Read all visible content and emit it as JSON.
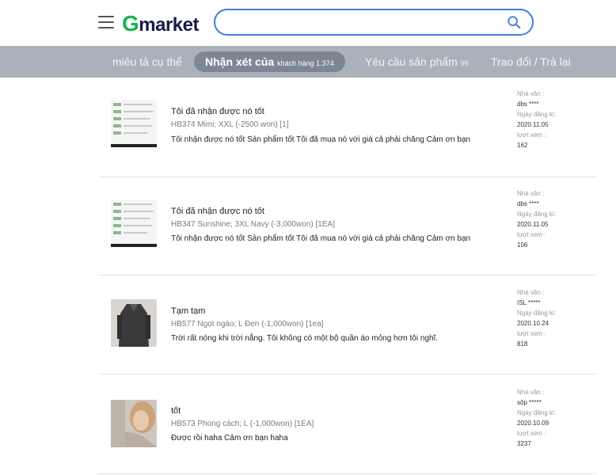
{
  "header": {
    "logo_g": "G",
    "logo_rest": "market",
    "search_placeholder": "",
    "brand_color": "#16b34a"
  },
  "tabs": [
    {
      "label": "miêu tả cụ thể",
      "extra": ""
    },
    {
      "label": "Nhận xét của",
      "extra": "khách hàng 1.374"
    },
    {
      "label": "Yêu cầu sản phẩm",
      "extra": "99"
    },
    {
      "label": "Trao đổi / Trả lại",
      "extra": ""
    }
  ],
  "active_tab": 1,
  "meta_labels": {
    "author": "Nhà văn :",
    "date": "Ngày đăng kí:",
    "views": "lượt xem :"
  },
  "reviews": [
    {
      "title": "Tôi đã nhận được nó tốt",
      "option": "HB374 Mimi; XXL (-2500 won) [1]",
      "text": "Tôi nhận được nó tốt Sản phẩm tốt Tôi đã mua nó với giá cả phải chăng Cảm ơn bạn",
      "author": "dbs ****",
      "date": "2020.11.05",
      "views": "162",
      "thumb": "screenshot"
    },
    {
      "title": "Tôi đã nhận được nó tốt",
      "option": "HB347 Sunshine; 3XL Navy (-3,000won) [1EA]",
      "text": "Tôi nhận được nó tốt Sản phẩm tốt Tôi đã mua nó với giá cả phải chăng Cảm ơn bạn",
      "author": "dbs ****",
      "date": "2020.11.05",
      "views": "106",
      "thumb": "screenshot"
    },
    {
      "title": "Tạm tạm",
      "option": "HB577 Ngọt ngào; L Đen (-1,000won) [1ea]",
      "text": "Trời rất nóng khi trời nắng. Tôi không có một bộ quần áo mỏng hơn tôi nghĩ.",
      "author": "ISL *****",
      "date": "2020.10.24",
      "views": "818",
      "thumb": "dark-coat"
    },
    {
      "title": "tốt",
      "option": "HB573 Phong cách; L (-1,000won) [1EA]",
      "text": "Được rồi haha Cảm ơn bạn haha",
      "author": "sộp *****",
      "date": "2020.10.09",
      "views": "3237",
      "thumb": "person-photo"
    }
  ]
}
